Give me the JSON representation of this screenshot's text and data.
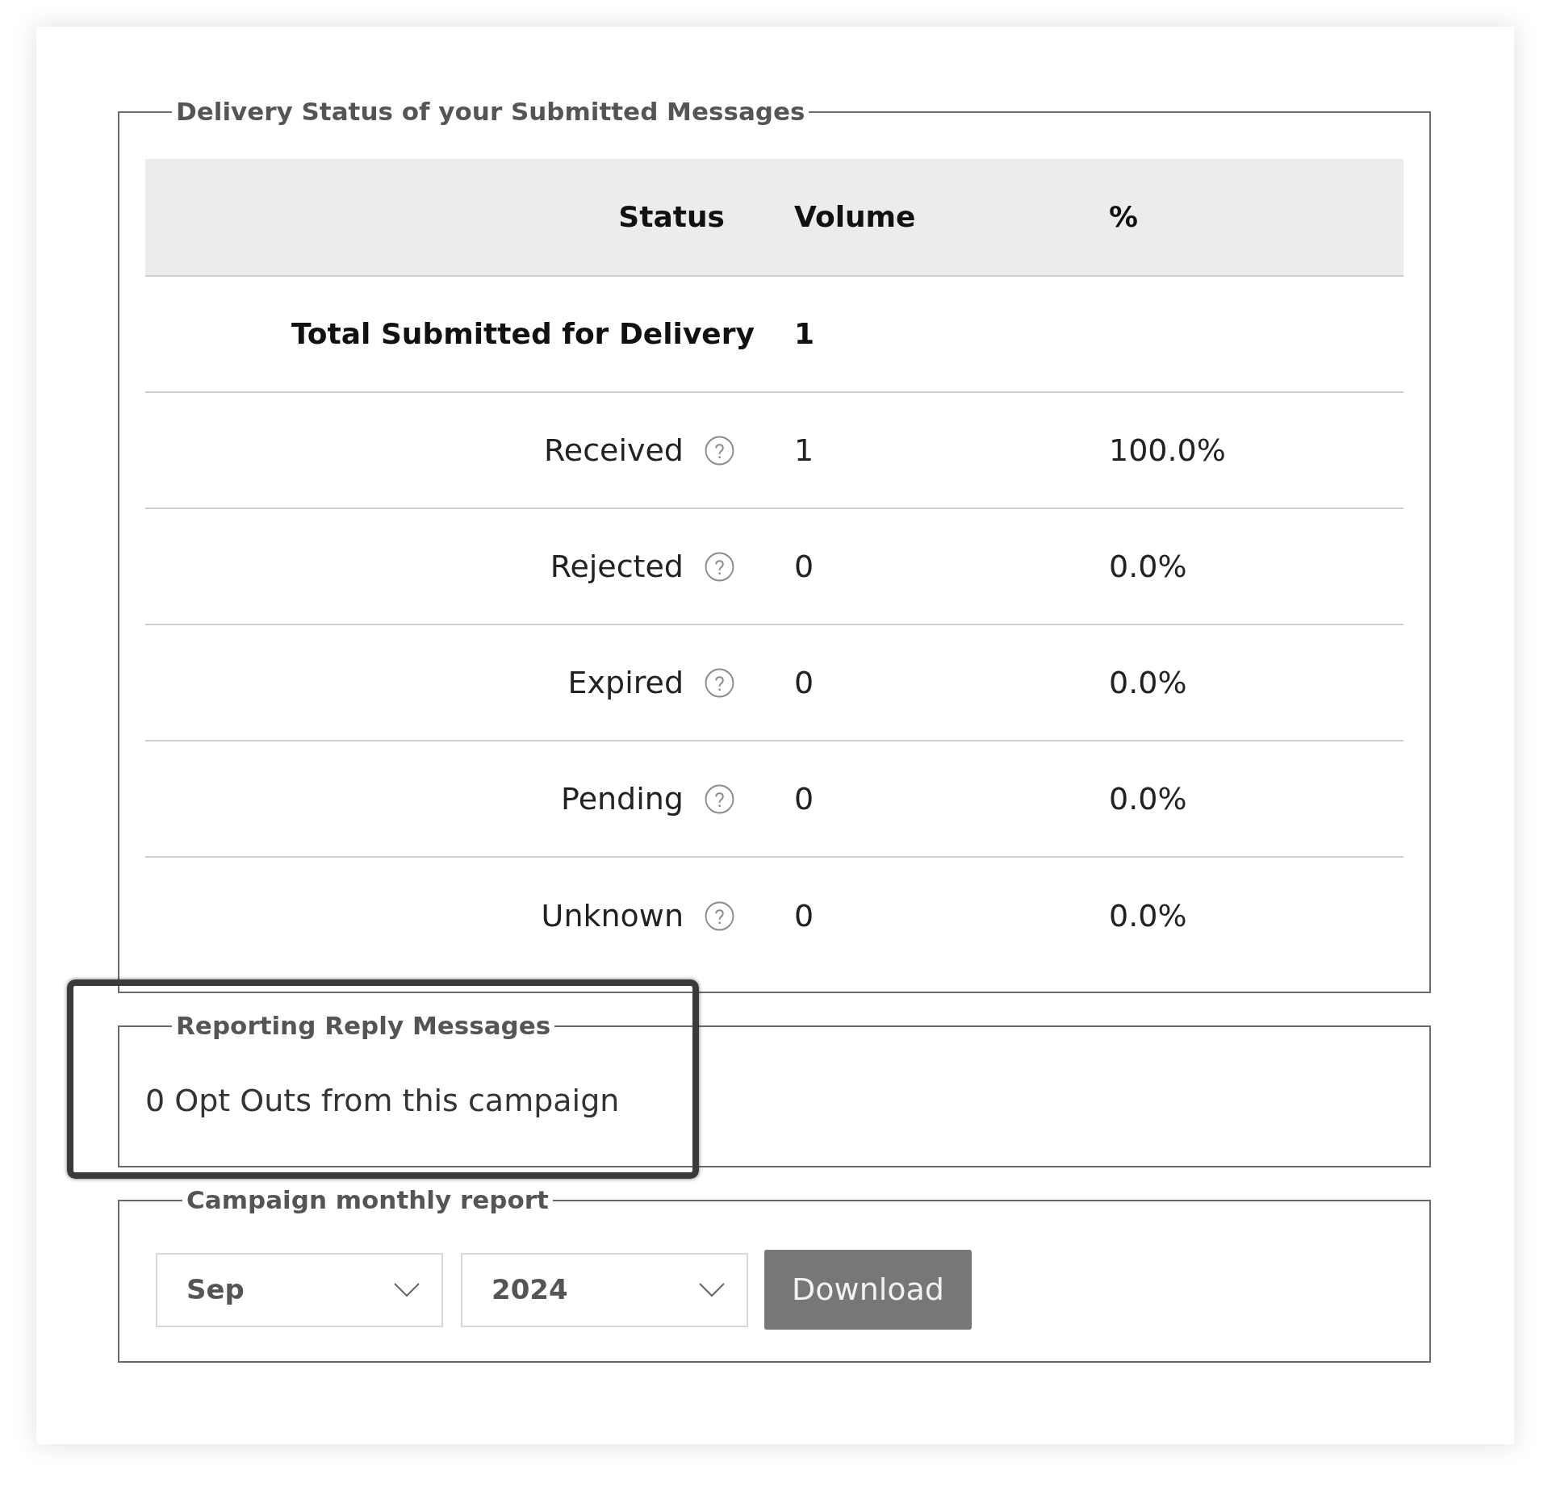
{
  "delivery_status": {
    "legend": "Delivery Status of your Submitted Messages",
    "columns": [
      "Status",
      "Volume",
      "%"
    ],
    "rows": [
      {
        "kind": "total",
        "status": "Total Submitted for Delivery",
        "volume": "1"
      },
      {
        "kind": "detail",
        "status": "Received",
        "volume": "1",
        "percent": "100.0%"
      },
      {
        "kind": "detail",
        "status": "Rejected",
        "volume": "0",
        "percent": "0.0%"
      },
      {
        "kind": "detail",
        "status": "Expired",
        "volume": "0",
        "percent": "0.0%"
      },
      {
        "kind": "detail",
        "status": "Pending",
        "volume": "0",
        "percent": "0.0%"
      },
      {
        "kind": "detail",
        "status": "Unknown",
        "volume": "0",
        "percent": "0.0%"
      }
    ]
  },
  "reply_messages": {
    "legend": "Reporting Reply Messages",
    "text": "0 Opt Outs from this campaign"
  },
  "monthly_report": {
    "legend": "Campaign monthly report",
    "month_select": {
      "value": "Sep"
    },
    "year_select": {
      "value": "2024"
    },
    "download_button": "Download"
  }
}
